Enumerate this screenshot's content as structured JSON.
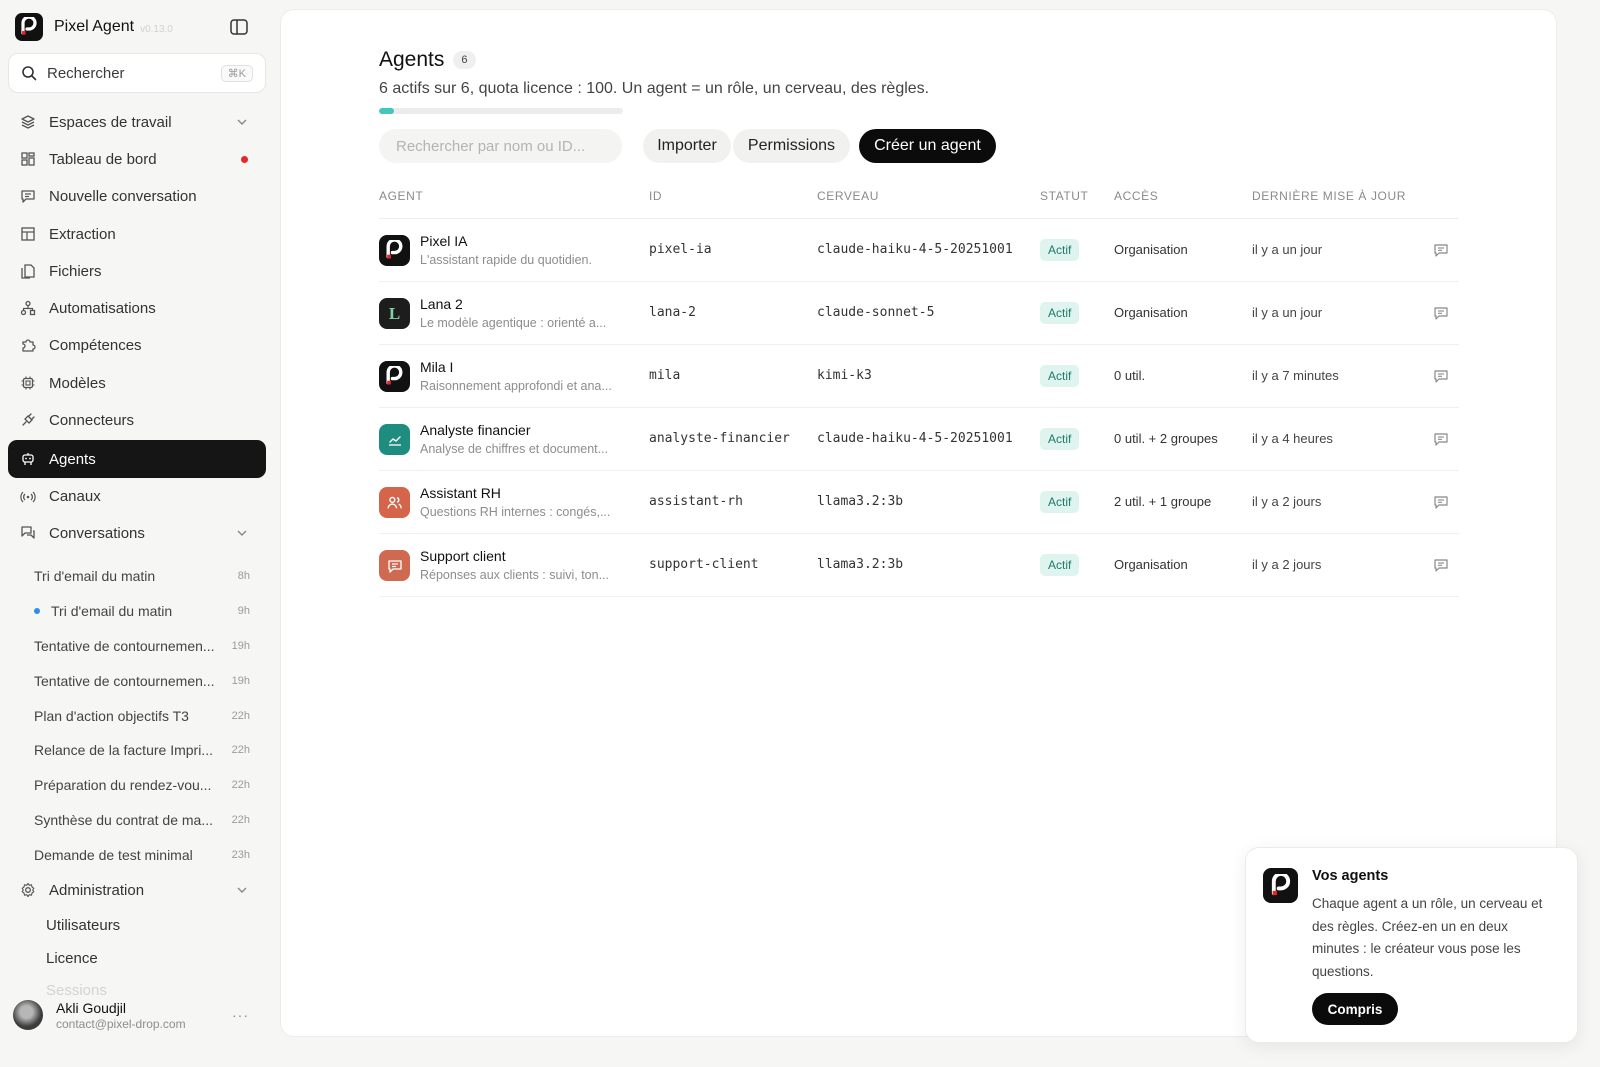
{
  "app": {
    "name": "Pixel Agent",
    "version": "v0.13.0"
  },
  "search": {
    "label": "Rechercher",
    "shortcut": "⌘K"
  },
  "nav": [
    {
      "label": "Espaces de travail",
      "icon": "layers-icon"
    },
    {
      "label": "Tableau de bord",
      "icon": "dashboard-icon"
    },
    {
      "label": "Nouvelle conversation",
      "icon": "new-chat-icon"
    },
    {
      "label": "Extraction",
      "icon": "table-icon"
    },
    {
      "label": "Fichiers",
      "icon": "files-icon"
    },
    {
      "label": "Automatisations",
      "icon": "workflow-icon"
    },
    {
      "label": "Compétences",
      "icon": "puzzle-icon"
    },
    {
      "label": "Modèles",
      "icon": "chip-icon"
    },
    {
      "label": "Connecteurs",
      "icon": "plug-icon"
    },
    {
      "label": "Agents",
      "icon": "bot-icon",
      "active": true
    },
    {
      "label": "Canaux",
      "icon": "broadcast-icon"
    },
    {
      "label": "Conversations",
      "icon": "chats-icon"
    }
  ],
  "conversations": [
    {
      "title": "Tri d'email du matin",
      "time": "8h"
    },
    {
      "title": "Tri d'email du matin",
      "time": "9h",
      "unread": true
    },
    {
      "title": "Tentative de contournemen...",
      "time": "19h"
    },
    {
      "title": "Tentative de contournemen...",
      "time": "19h"
    },
    {
      "title": "Plan d'action objectifs T3",
      "time": "22h"
    },
    {
      "title": "Relance de la facture Impri...",
      "time": "22h"
    },
    {
      "title": "Préparation du rendez-vou...",
      "time": "22h"
    },
    {
      "title": "Synthèse du contrat de ma...",
      "time": "22h"
    },
    {
      "title": "Demande de test minimal",
      "time": "23h"
    }
  ],
  "admin": {
    "label": "Administration",
    "items": [
      "Utilisateurs",
      "Licence",
      "Sessions"
    ]
  },
  "user": {
    "name": "Akli Goudjil",
    "email": "contact@pixel-drop.com",
    "more": "···"
  },
  "page": {
    "title": "Agents",
    "count": "6",
    "subtitle": "6 actifs sur 6, quota licence : 100. Un agent = un rôle, un cerveau, des règles.",
    "quota_used_fraction": 0.06,
    "filter_placeholder": "Rechercher par nom ou ID...",
    "import_label": "Importer",
    "permissions_label": "Permissions",
    "create_label": "Créer un agent"
  },
  "table": {
    "headers": [
      "AGENT",
      "ID",
      "CERVEAU",
      "STATUT",
      "ACCÈS",
      "DERNIÈRE MISE À JOUR"
    ],
    "rows": [
      {
        "name": "Pixel IA",
        "desc": "L'assistant rapide du quotidien.",
        "id": "pixel-ia",
        "brain": "claude-haiku-4-5-20251001",
        "status": "Actif",
        "access": "Organisation",
        "updated": "il y a un jour",
        "avatar": "pixel-logo",
        "avatar_color": "#111111"
      },
      {
        "name": "Lana 2",
        "desc": "Le modèle agentique : orienté a...",
        "id": "lana-2",
        "brain": "claude-sonnet-5",
        "status": "Actif",
        "access": "Organisation",
        "updated": "il y a un jour",
        "avatar": "letter-l",
        "avatar_letter": "L",
        "avatar_color": "#1d1d1d"
      },
      {
        "name": "Mila I",
        "desc": "Raisonnement approfondi et ana...",
        "id": "mila",
        "brain": "kimi-k3",
        "status": "Actif",
        "access": "0 util.",
        "updated": "il y a 7 minutes",
        "avatar": "pixel-logo",
        "avatar_color": "#111111"
      },
      {
        "name": "Analyste financier",
        "desc": "Analyse de chiffres et document...",
        "id": "analyste-financier",
        "brain": "claude-haiku-4-5-20251001",
        "status": "Actif",
        "access": "0 util. + 2 groupes",
        "updated": "il y a 4 heures",
        "avatar": "chart-icon",
        "avatar_color": "#1f8c80"
      },
      {
        "name": "Assistant RH",
        "desc": "Questions RH internes : congés,...",
        "id": "assistant-rh",
        "brain": "llama3.2:3b",
        "status": "Actif",
        "access": "2 util. + 1 groupe",
        "updated": "il y a 2 jours",
        "avatar": "users-icon",
        "avatar_color": "#d4654b"
      },
      {
        "name": "Support client",
        "desc": "Réponses aux clients : suivi, ton...",
        "id": "support-client",
        "brain": "llama3.2:3b",
        "status": "Actif",
        "access": "Organisation",
        "updated": "il y a 2 jours",
        "avatar": "message-icon",
        "avatar_color": "#cf6a50"
      }
    ]
  },
  "tour": {
    "title": "Vos agents",
    "text": "Chaque agent a un rôle, un cerveau et des règles. Créez-en un en deux minutes : le créateur vous pose les questions.",
    "button": "Compris"
  },
  "colors": {
    "accent": "#3fc7c0",
    "status_bg": "#dff3ef",
    "status_fg": "#1f7a69",
    "active_nav": "#151515",
    "notification": "#e5262b"
  }
}
